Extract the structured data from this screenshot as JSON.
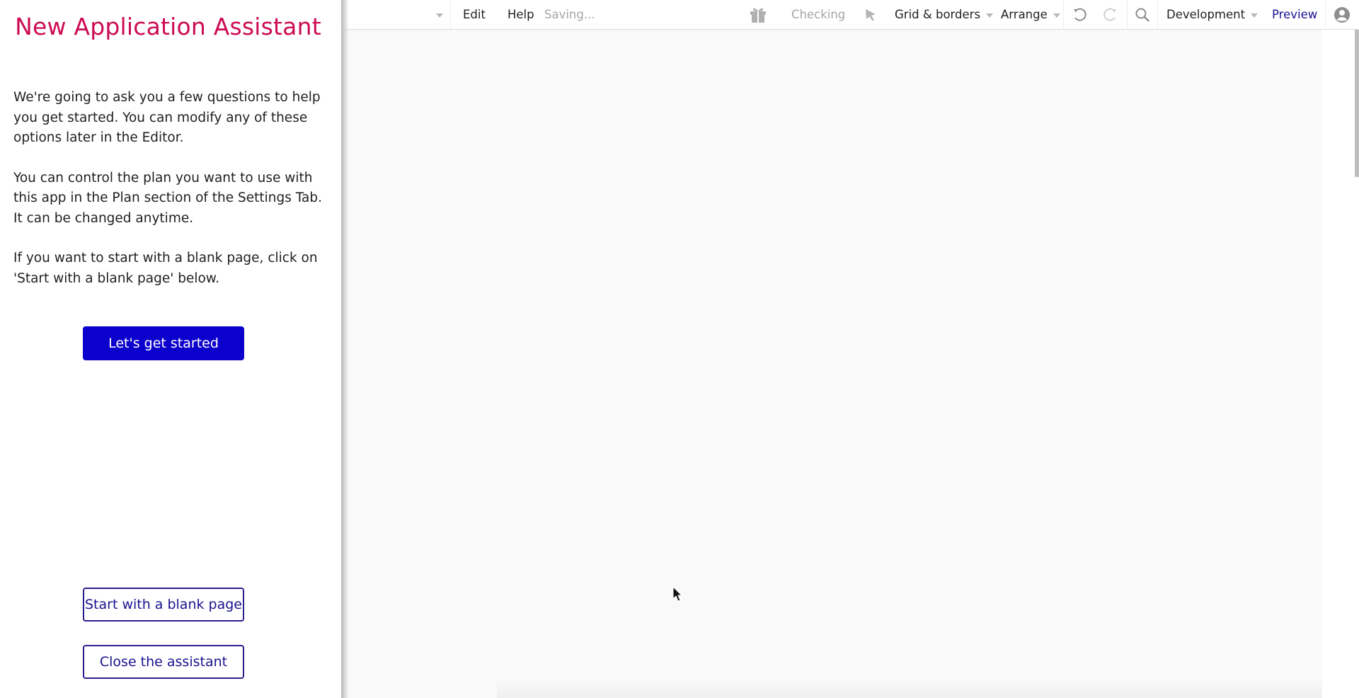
{
  "assistant": {
    "title": "New Application Assistant",
    "paragraphs": [
      "We're going to ask you a few questions to help you get started. You can modify any of these options later in the Editor.",
      "You can control the plan you want to use with this app in the Plan section of the Settings Tab. It can be changed anytime.",
      "If you want to start with a blank page, click on 'Start with a blank page' below."
    ],
    "primary_button": "Let's get started",
    "blank_page_button": "Start with a blank page",
    "close_button": "Close the assistant"
  },
  "toolbar": {
    "menu_edit": "Edit",
    "menu_help": "Help",
    "save_status": "Saving...",
    "issues_status": "Checking",
    "grid_borders": "Grid & borders",
    "arrange": "Arrange",
    "environment": "Development",
    "preview": "Preview",
    "icons": {
      "page_dropdown": "chevron-down-icon",
      "gift": "gift-icon",
      "select": "cursor-arrow-icon",
      "undo": "undo-icon",
      "redo": "redo-icon",
      "search": "search-icon",
      "account": "user-avatar-icon"
    }
  },
  "colors": {
    "title": "#cc0b53",
    "primary": "#0c00cc",
    "outline": "#2a1f8f",
    "preview_link": "#1a128f",
    "canvas": "#f9f9f9"
  }
}
